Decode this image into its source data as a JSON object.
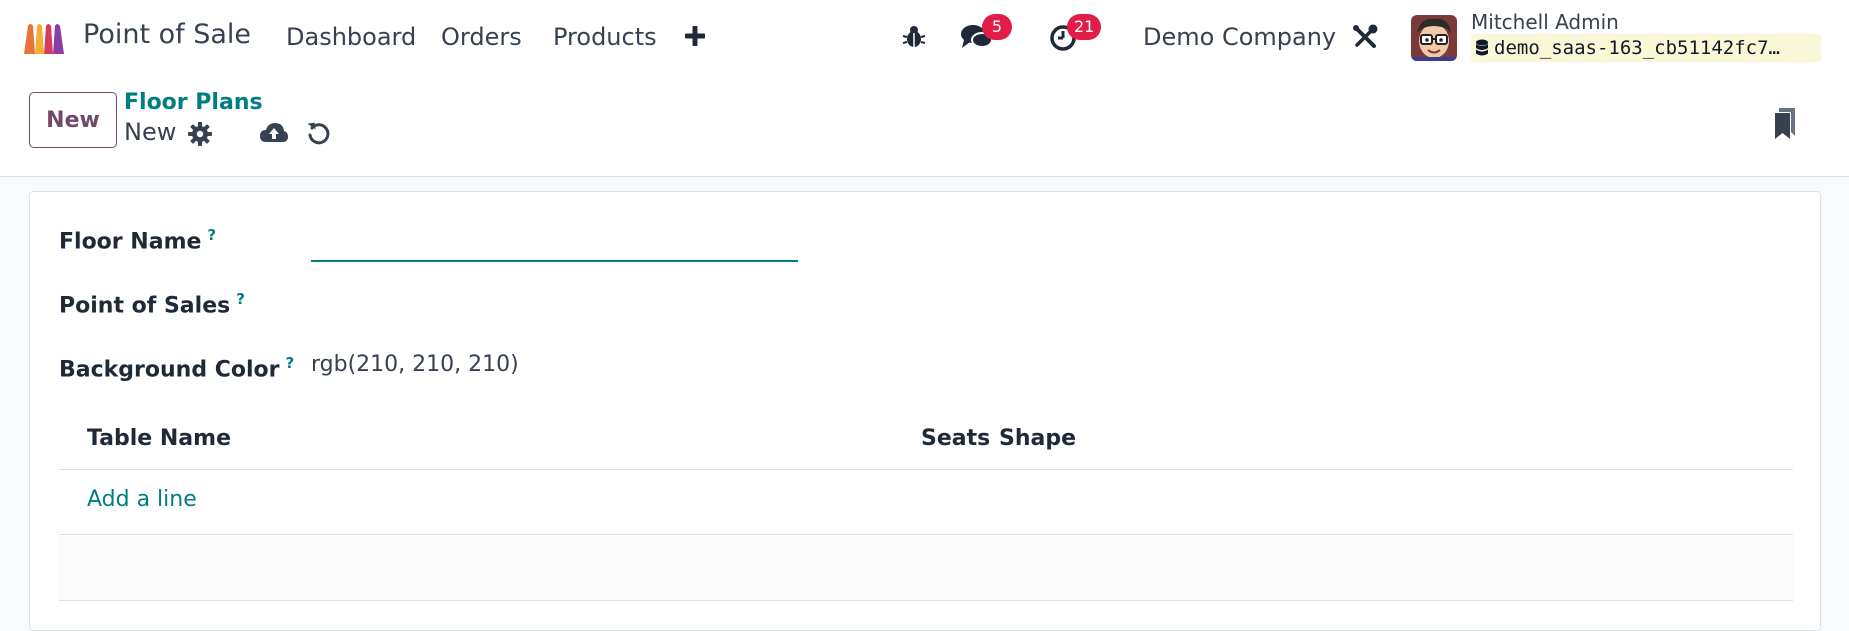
{
  "navbar": {
    "app_name": "Point of Sale",
    "menu": [
      "Dashboard",
      "Orders",
      "Products"
    ],
    "messages_badge": "5",
    "activities_badge": "21",
    "company": "Demo Company",
    "user_name": "Mitchell Admin",
    "database": "demo_saas-163_cb51142fc7…",
    "icons": [
      "app-logo-icon",
      "plus-icon",
      "bug-icon",
      "chat-icon",
      "clock-icon",
      "tools-icon",
      "database-icon"
    ]
  },
  "control_panel": {
    "new_button": "New",
    "breadcrumb_parent": "Floor Plans",
    "breadcrumb_current": "New",
    "icons": [
      "gear-icon",
      "cloud-upload-icon",
      "discard-icon",
      "bookmark-icon"
    ]
  },
  "form": {
    "floor_name_label": "Floor Name",
    "floor_name_value": "",
    "point_of_sales_label": "Point of Sales",
    "background_color_label": "Background Color",
    "background_color_value": "rgb(210, 210, 210)",
    "help_mark": "?",
    "table": {
      "columns": [
        "Table Name",
        "Seats",
        "Shape"
      ],
      "add_line": "Add a line",
      "rows": []
    }
  },
  "colors": {
    "brand": "#714b67",
    "link": "#017e84",
    "badge": "#e11d48",
    "db_chip": "#fbf8d8"
  }
}
